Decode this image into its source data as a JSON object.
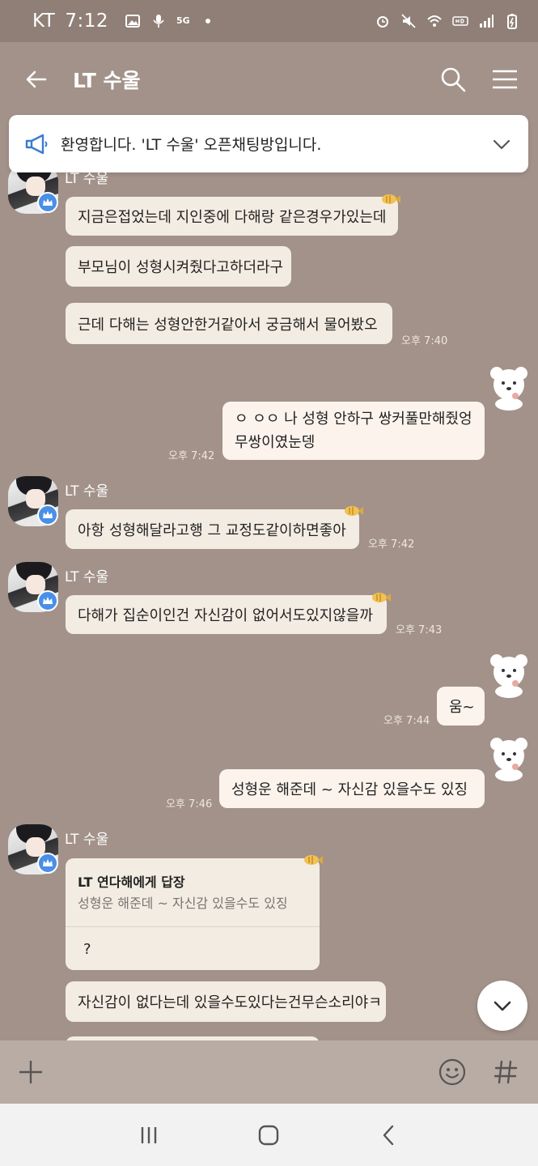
{
  "status_bar": {
    "carrier": "KT",
    "time": "7:12",
    "signal_badge": "5G"
  },
  "header": {
    "title": "LT 수울"
  },
  "notice": {
    "text": "환영합니다. 'LT 수울' 오픈채팅방입니다."
  },
  "colors": {
    "chat_bg": "#a2928a",
    "bubble_other": "#f3ece2",
    "bubble_mine": "#fbf3ec",
    "badge": "#4a8fe8"
  },
  "messages": {
    "g1": {
      "sender": "LT 수울",
      "b1": "지금은접었는데 지인중에 다해랑 같은경우가있는데",
      "b2": "부모님이 성형시켜줬다고하더라구",
      "b3": "근데 다해는 성형안한거같아서 궁금해서 물어봤오",
      "time": "오후 7:40"
    },
    "m1": {
      "line1": "ㅇ ㅇㅇ 나 성형 안하구 쌍커풀만해줬엉",
      "line2": "무쌍이였눈뎅",
      "time": "오후 7:42"
    },
    "g2": {
      "sender": "LT 수울",
      "text": "아항 성형해달라고행 그 교정도같이하면좋아",
      "time": "오후 7:42"
    },
    "g3": {
      "sender": "LT 수울",
      "text": "다해가 집순이인건 자신감이 없어서도있지않을까",
      "time": "오후 7:43"
    },
    "m2": {
      "text": "움~",
      "time": "오후 7:44"
    },
    "m3": {
      "text": "성형운 해준데 ~  자신감 있을수도 있징",
      "time": "오후 7:46"
    },
    "g4": {
      "sender": "LT 수울",
      "reply_title": "LT 연다해에게 답장",
      "reply_quote": "성형운 해준데 ~  자신감 있을수도 있징",
      "reply_text": "?",
      "text": "자신감이 없다는데 있을수도있다는건무슨소리야ㅋ"
    }
  }
}
